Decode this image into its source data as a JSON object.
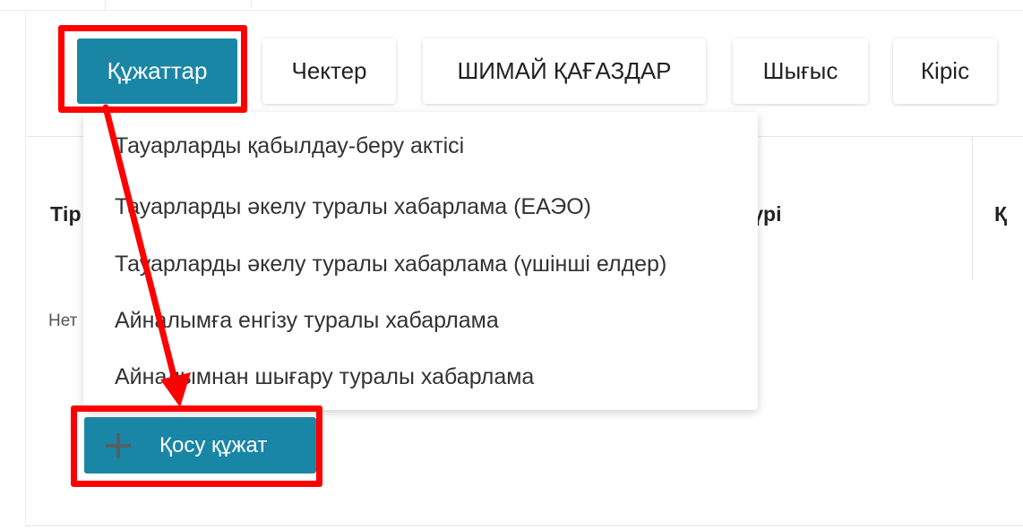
{
  "tabs": [
    {
      "label": "Құжаттар",
      "active": true
    },
    {
      "label": "Чектер",
      "active": false
    },
    {
      "label": "ШИМАЙ ҚАҒАЗДАР",
      "active": false
    },
    {
      "label": "Шығыс",
      "active": false
    },
    {
      "label": "Кіріс",
      "active": false
    }
  ],
  "table": {
    "headers": [
      "Тір",
      "түрі",
      "Қ"
    ],
    "empty_text": "Нет"
  },
  "dropdown": {
    "items": [
      "Тауарларды қабылдау-беру актісі",
      "Тауарларды әкелу туралы хабарлама (ЕАЭО)",
      "Тауарларды әкелу туралы хабарлама (үшінші елдер)",
      "Айналымға енгізу туралы хабарлама",
      "Айналымнан шығару туралы хабарлама"
    ]
  },
  "add_button": {
    "label": "Қосу құжат",
    "icon": "plus-icon"
  },
  "colors": {
    "accent": "#1a86a6",
    "annotation": "#ff0000"
  }
}
